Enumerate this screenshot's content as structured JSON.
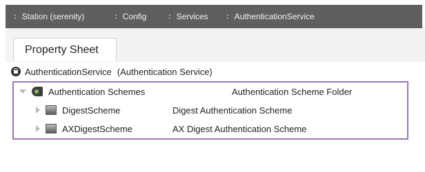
{
  "breadcrumb": {
    "items": [
      {
        "sep": ":",
        "label": "Station (serenity)"
      },
      {
        "sep": ":",
        "label": "Config"
      },
      {
        "sep": ":",
        "label": "Services"
      },
      {
        "sep": ":",
        "label": "AuthenticationService"
      }
    ]
  },
  "tabs": {
    "active_label": "Property Sheet"
  },
  "tree": {
    "root": {
      "name": "AuthenticationService",
      "type": "(Authentication Service)"
    },
    "folder": {
      "name": "Authentication Schemes",
      "type": "Authentication Scheme Folder"
    },
    "children": [
      {
        "name": "DigestScheme",
        "type": "Digest Authentication Scheme"
      },
      {
        "name": "AXDigestScheme",
        "type": "AX Digest Authentication Scheme"
      }
    ]
  },
  "colors": {
    "breadcrumb_bg": "#5f5f5f",
    "highlight_border": "#9a76b5"
  }
}
